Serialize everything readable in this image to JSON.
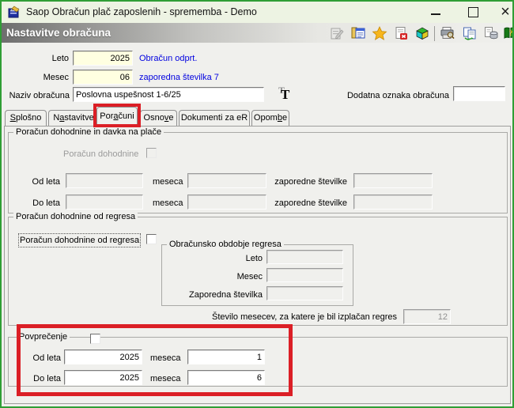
{
  "window": {
    "title": "Saop Obračun plač zaposlenih - sprememba - Demo"
  },
  "panel_header": {
    "title": "Nastavitve obračuna"
  },
  "toolbar": {
    "icons": [
      "edit-record-icon (disabled)",
      "records-list-icon",
      "favorites-star-icon",
      "delete-document-icon",
      "cube-icon",
      "print-preview-icon",
      "copy-refresh-icon",
      "data-export-icon",
      "help-book-icon"
    ]
  },
  "form": {
    "leto_label": "Leto",
    "leto_value": "2025",
    "leto_status": "Obračun odprt.",
    "mesec_label": "Mesec",
    "mesec_value": "06",
    "mesec_status": "zaporedna številka 7",
    "naziv_label": "Naziv obračuna",
    "naziv_value": "Poslovna uspešnost 1-6/25",
    "font_button_glyph_front": "T",
    "font_button_glyph_back": "T",
    "dodatna_label": "Dodatna oznaka obračuna",
    "dodatna_value": ""
  },
  "tabs": [
    {
      "pre": "",
      "key": "S",
      "post": "plošno"
    },
    {
      "pre": "N",
      "key": "a",
      "post": "stavitve"
    },
    {
      "pre": "Por",
      "key": "a",
      "post": "čuni"
    },
    {
      "pre": "Osno",
      "key": "v",
      "post": "e"
    },
    {
      "pre": "",
      "key": "",
      "post": "Dokumenti za eR"
    },
    {
      "pre": "Opom",
      "key": "b",
      "post": "e"
    }
  ],
  "group_dohodnina": {
    "title": "Poračun dohodnine in davka na plače",
    "checkbox_label": "Poračun dohodnine",
    "od_label": "Od leta",
    "do_label": "Do leta",
    "meseca_label": "meseca",
    "zap_label": "zaporedne številke",
    "od_leta": "",
    "od_meseca": "",
    "od_zap": "",
    "do_leta": "",
    "do_meseca": "",
    "do_zap": ""
  },
  "group_regres": {
    "title": "Poračun dohodnine od regresa",
    "checkbox_label": "Poračun dohodnine od regresa",
    "obdobje_title": "Obračunsko obdobje regresa",
    "leto_label": "Leto",
    "mesec_label": "Mesec",
    "zap_label": "Zaporedna številka",
    "leto_value": "",
    "mesec_value": "",
    "zap_value": "",
    "months_label": "Število mesecev, za katere je bil izplačan  regres",
    "months_value": "12"
  },
  "group_povprecenje": {
    "title": "Povprečenje",
    "od_label": "Od leta",
    "do_label": "Do leta",
    "meseca_label": "meseca",
    "od_year": "2025",
    "od_month": "1",
    "do_year": "2025",
    "do_month": "6"
  },
  "colors": {
    "window_border_green": "#2f9e35",
    "annotation_red": "#db1f26",
    "field_yellow": "#ffffe1",
    "status_blue": "#0202e0",
    "header_gradient_dark": "#6e6e6e",
    "dialog_bg": "#f0f0ed"
  }
}
